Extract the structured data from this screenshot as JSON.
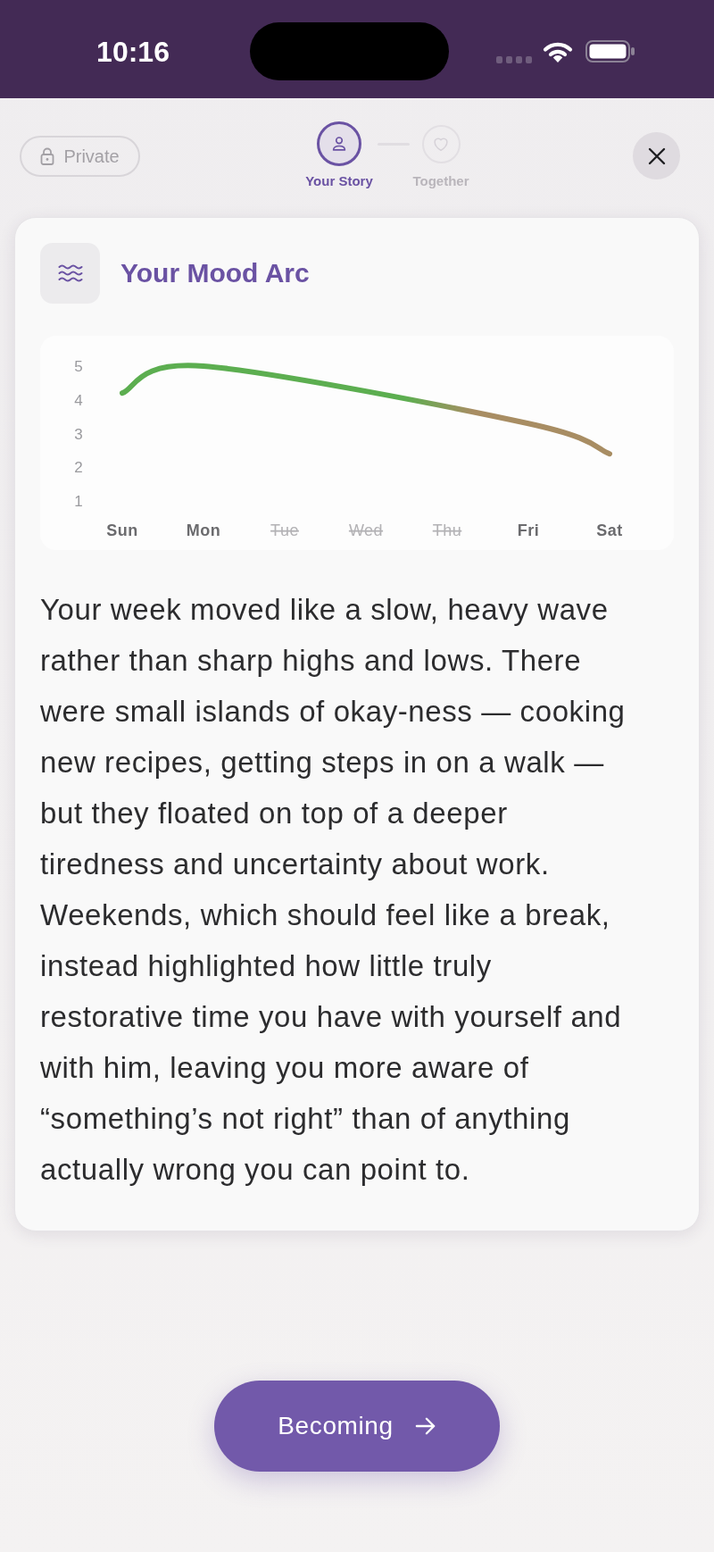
{
  "status_bar": {
    "time": "10:16"
  },
  "header": {
    "privacy_button": {
      "label": "Private"
    },
    "steps": [
      {
        "label": "Your Story",
        "kind": "personal",
        "selected": true
      },
      {
        "label": "Together",
        "kind": "shared",
        "selected": false
      }
    ]
  },
  "card": {
    "title": "Your Mood Arc",
    "mood_chart": {
      "chart_data": {
        "type": "line",
        "categories": [
          "Sun",
          "Mon",
          "Tue",
          "Wed",
          "Thu",
          "Fri",
          "Sat"
        ],
        "series": [
          {
            "color": "#5cae50",
            "values": [
              4.2,
              5,
              null,
              null,
              null,
              3.3,
              2.4
            ]
          }
        ],
        "ylim": [
          1,
          5
        ],
        "yticks": [
          1,
          2,
          3,
          4,
          5
        ]
      }
    },
    "summary": "Your week moved like a slow, heavy wave rather than sharp highs and lows. There were small islands of okay-ness — cooking new recipes, getting steps in on a walk — but they floated on top of a deeper tiredness and uncertainty about work. Weekends, which should feel like a break, instead highlighted how little truly restorative time you have with yourself and with him, leaving you more aware of “something’s not right” than of anything actually wrong you can point to."
  },
  "next_button": {
    "label": "Becoming"
  }
}
